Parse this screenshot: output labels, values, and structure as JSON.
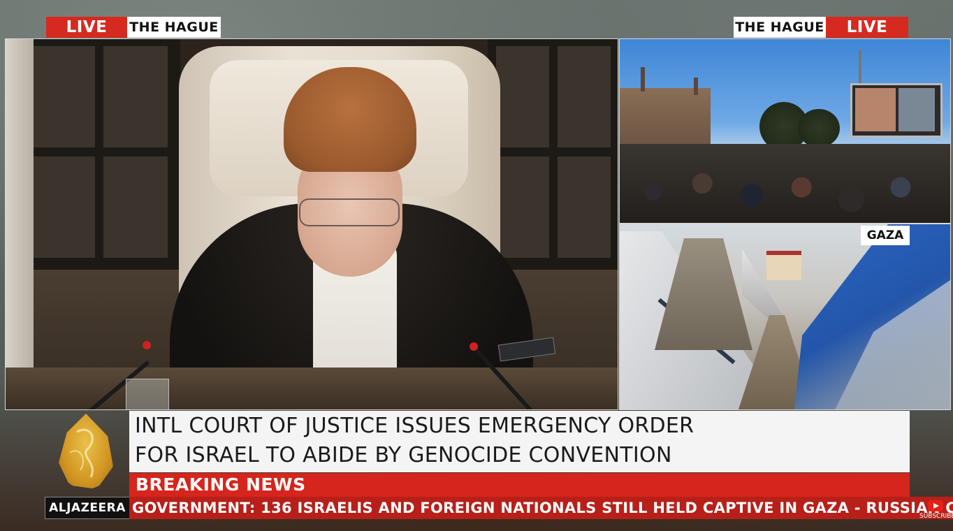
{
  "top_left": {
    "live_label": "LIVE",
    "location": "THE HAGUE"
  },
  "top_right": {
    "location": "THE HAGUE",
    "live_label": "LIVE"
  },
  "gaza_label": "GAZA",
  "headline": {
    "line1": "INTL COURT OF JUSTICE ISSUES EMERGENCY ORDER",
    "line2": "FOR ISRAEL TO ABIDE BY GENOCIDE CONVENTION"
  },
  "breaking_label": "BREAKING NEWS",
  "ticker_text": "GOVERNMENT: 136 ISRAELIS AND FOREIGN NATIONALS STILL HELD CAPTIVE IN GAZA   -   RUSSIAN CO",
  "brand": {
    "name": "ALJAZEERA"
  },
  "subscribe_label": "SUBSCRIBE",
  "colors": {
    "live_red": "#d62a20",
    "ticker_red": "#b81f18",
    "logo_gold": "#e0a62a"
  },
  "icons": [
    "aljazeera-logo-icon",
    "youtube-subscribe-icon"
  ]
}
